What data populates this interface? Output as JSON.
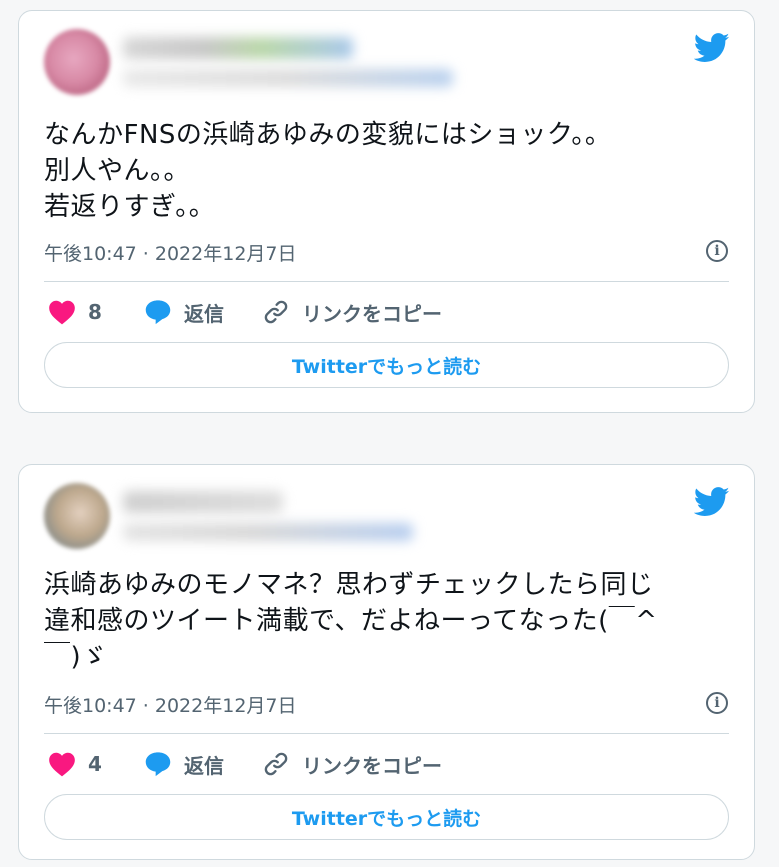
{
  "brand_color": "#1d9bf0",
  "like_color": "#f91880",
  "tweets": [
    {
      "text": "なんかFNSの浜崎あゆみの変貌にはショック。。\n別人やん。。\n若返りすぎ。。",
      "timestamp": "午後10:47 · 2022年12月7日",
      "likes": "8",
      "reply_label": "返信",
      "copy_link_label": "リンクをコピー",
      "read_more_label": "Twitterでもっと読む"
    },
    {
      "text": "浜崎あゆみのモノマネ？思わずチェックしたら同じ\n違和感のツイート満載で、だよねーってなった(￣^\n￣)ゞ",
      "timestamp": "午後10:47 · 2022年12月7日",
      "likes": "4",
      "reply_label": "返信",
      "copy_link_label": "リンクをコピー",
      "read_more_label": "Twitterでもっと読む"
    }
  ],
  "icons": [
    "twitter-bird-icon",
    "info-icon",
    "heart-icon",
    "reply-bubble-icon",
    "link-icon"
  ]
}
